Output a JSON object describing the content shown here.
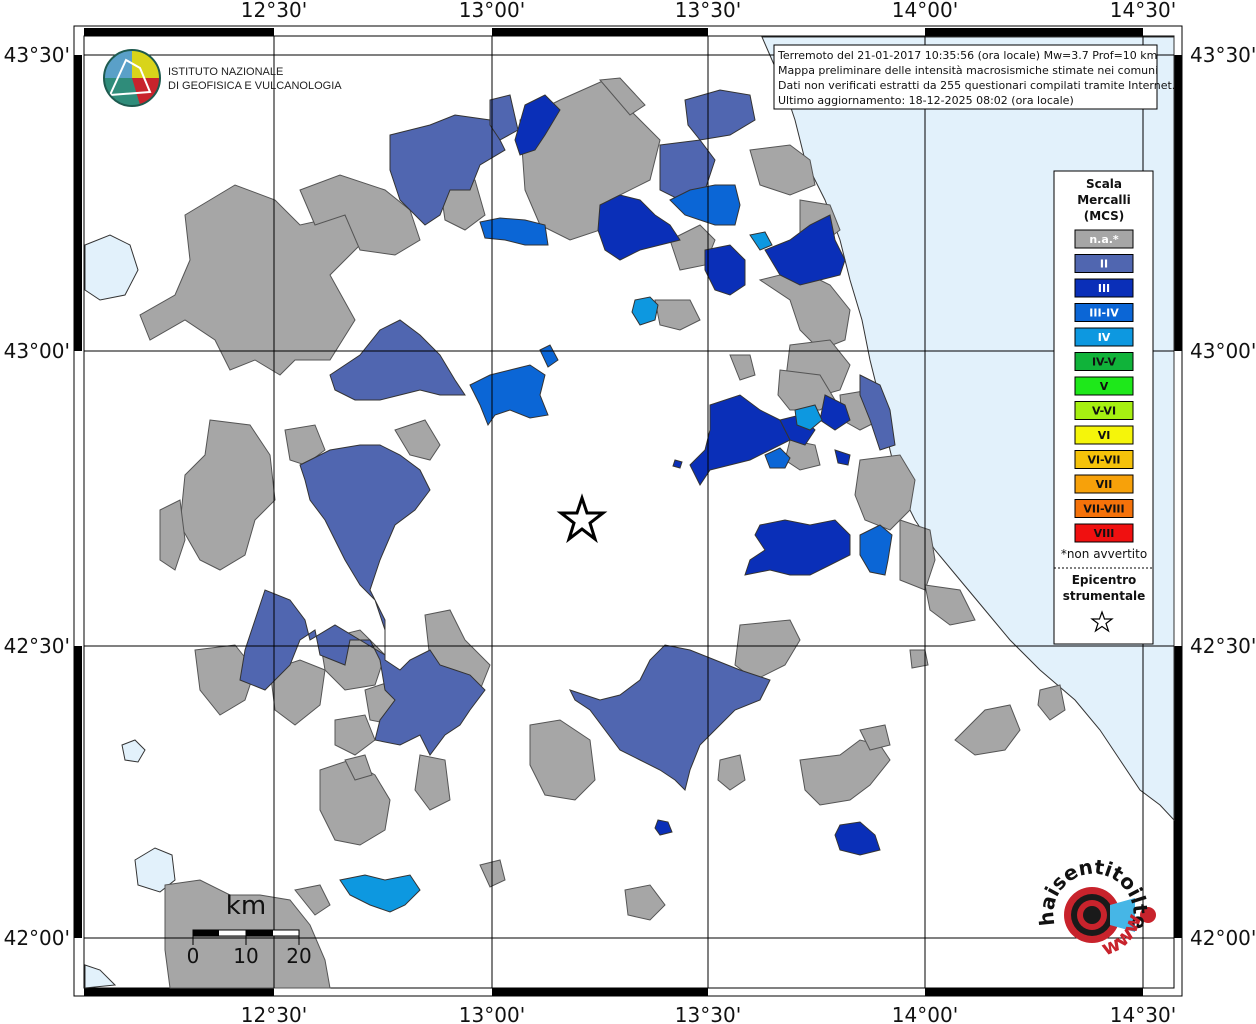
{
  "axes": {
    "lon_labels": [
      "12°30'",
      "13°00'",
      "13°30'",
      "14°00'",
      "14°30'"
    ],
    "lat_labels": [
      "43°30'",
      "43°00'",
      "42°30'",
      "42°00'"
    ]
  },
  "info_box": {
    "line1": "Terremoto del 21-01-2017 10:35:56 (ora locale) Mw=3.7 Prof=10 km",
    "line2": "Mappa preliminare delle intensità macrosismiche stimate nei comuni",
    "line3": "Dati non verificati estratti da 255 questionari compilati tramite Internet.",
    "line4": "Ultimo aggiornamento: 18-12-2025 08:02 (ora locale)"
  },
  "logo": {
    "line1": "ISTITUTO NAZIONALE",
    "line2": "DI GEOFISICA E VULCANOLOGIA"
  },
  "legend": {
    "title1": "Scala",
    "title2": "Mercalli",
    "title3": "(MCS)",
    "items": [
      {
        "label": "n.a.*",
        "color": "#a6a6a6"
      },
      {
        "label": "II",
        "color": "#5066b0"
      },
      {
        "label": "III",
        "color": "#0a2fb8"
      },
      {
        "label": "III-IV",
        "color": "#0b66d6"
      },
      {
        "label": "IV",
        "color": "#0d98e0"
      },
      {
        "label": "IV-V",
        "color": "#10b33a"
      },
      {
        "label": "V",
        "color": "#1ee81a"
      },
      {
        "label": "V-VI",
        "color": "#a6f011"
      },
      {
        "label": "VI",
        "color": "#f5f50a"
      },
      {
        "label": "VI-VII",
        "color": "#f5c20a"
      },
      {
        "label": "VII",
        "color": "#f7a10a"
      },
      {
        "label": "VII-VIII",
        "color": "#f5720a"
      },
      {
        "label": "VIII",
        "color": "#f01010"
      }
    ],
    "note": "*non avvertito",
    "epicenter1": "Epicentro",
    "epicenter2": "strumentale",
    "epicenter_icon": "star-icon"
  },
  "scale_bar": {
    "unit": "km",
    "labels": [
      "0",
      "10",
      "20"
    ]
  },
  "badge": {
    "text": "haisentitoilterremoto.it",
    "url_text": "www.",
    "icon": "earthquake-target-icon"
  },
  "colors": {
    "sea": "#e2f1fb",
    "na": "#a6a6a6",
    "II": "#5066b0",
    "III": "#0a2fb8",
    "III-IV": "#0b66d6",
    "IV": "#0d98e0"
  }
}
